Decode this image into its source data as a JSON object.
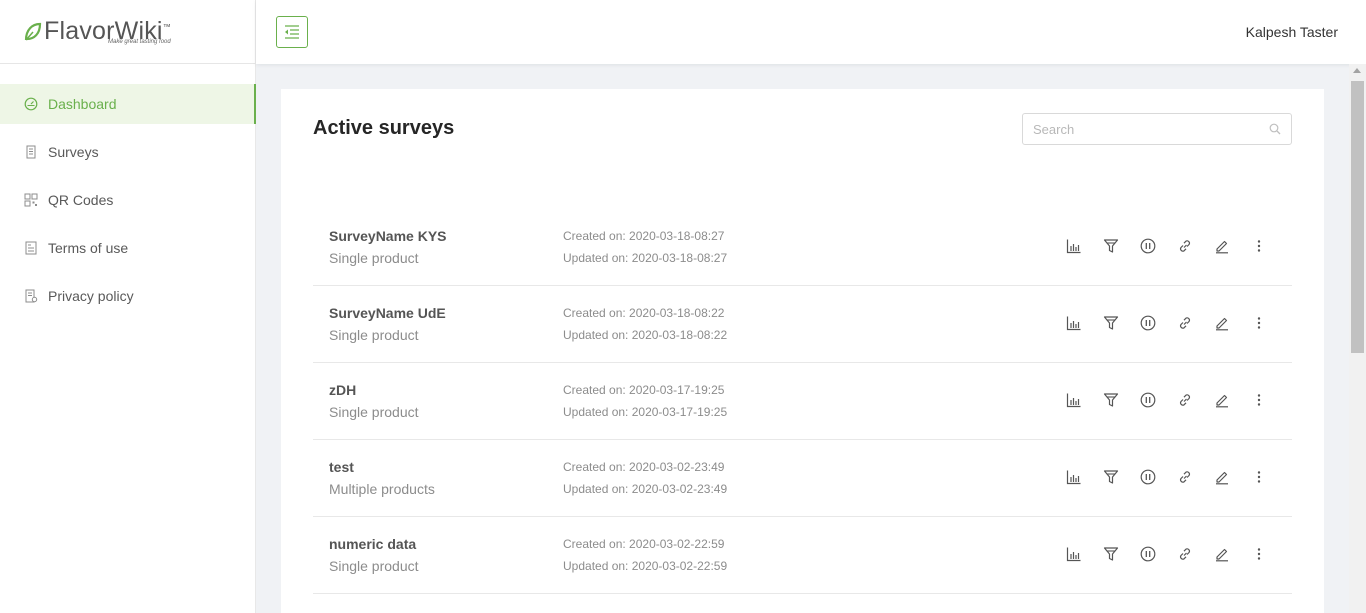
{
  "brand": {
    "name_a": "Flavor",
    "name_b": "Wiki",
    "mark": "™",
    "tagline": "Make great tasting food"
  },
  "sidebar": {
    "items": [
      {
        "label": "Dashboard",
        "icon": "dashboard-icon",
        "active": true
      },
      {
        "label": "Surveys",
        "icon": "survey-icon",
        "active": false
      },
      {
        "label": "QR Codes",
        "icon": "qr-code-icon",
        "active": false
      },
      {
        "label": "Terms of use",
        "icon": "terms-icon",
        "active": false
      },
      {
        "label": "Privacy policy",
        "icon": "privacy-icon",
        "active": false
      }
    ]
  },
  "header": {
    "user_name": "Kalpesh Taster"
  },
  "main": {
    "title": "Active surveys",
    "search_placeholder": "Search",
    "surveys": [
      {
        "name": "SurveyName KYS",
        "type": "Single product",
        "created": "Created on: 2020-03-18-08:27",
        "updated": "Updated on: 2020-03-18-08:27"
      },
      {
        "name": "SurveyName UdE",
        "type": "Single product",
        "created": "Created on: 2020-03-18-08:22",
        "updated": "Updated on: 2020-03-18-08:22"
      },
      {
        "name": "zDH",
        "type": "Single product",
        "created": "Created on: 2020-03-17-19:25",
        "updated": "Updated on: 2020-03-17-19:25"
      },
      {
        "name": "test",
        "type": "Multiple products",
        "created": "Created on: 2020-03-02-23:49",
        "updated": "Updated on: 2020-03-02-23:49"
      },
      {
        "name": "numeric data",
        "type": "Single product",
        "created": "Created on: 2020-03-02-22:59",
        "updated": "Updated on: 2020-03-02-22:59"
      }
    ]
  },
  "colors": {
    "accent": "#6ab04c",
    "background": "#f0f2f5"
  }
}
